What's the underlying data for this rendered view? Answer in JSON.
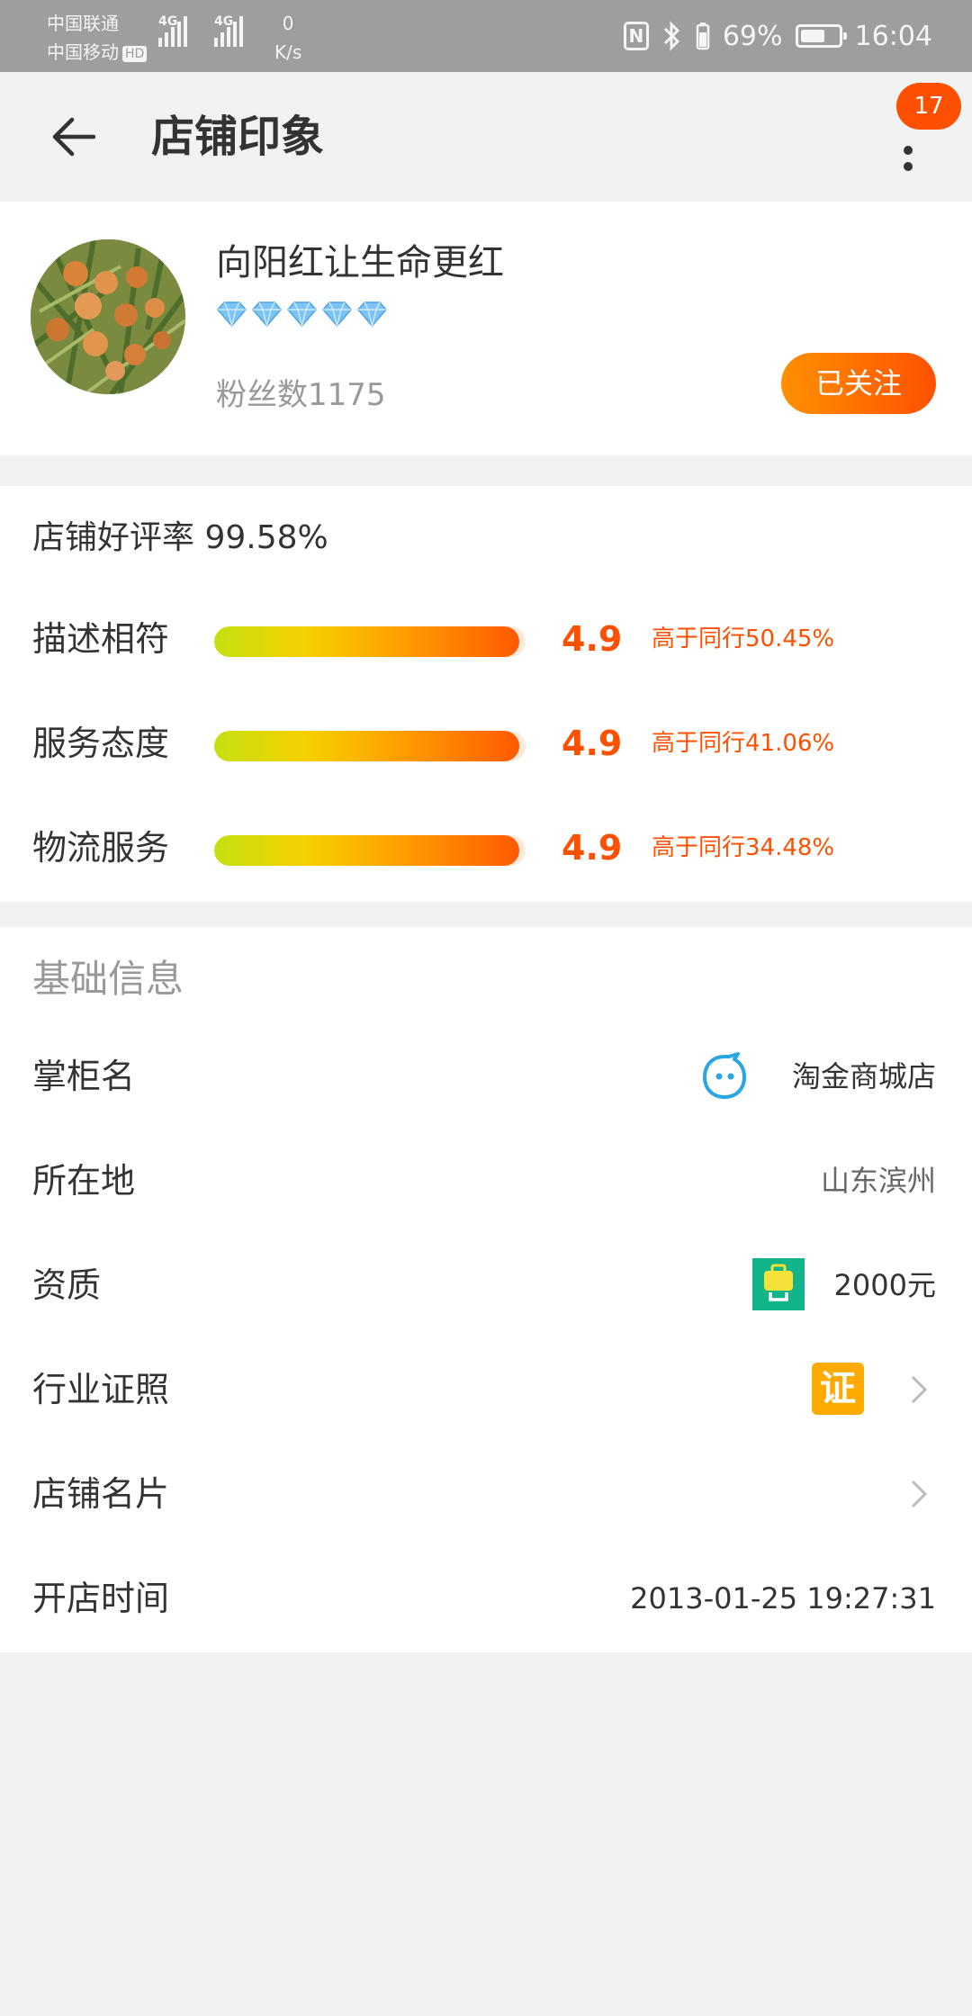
{
  "status_bar": {
    "carrier1": "中国联通",
    "carrier2": "中国移动",
    "hd": "HD",
    "net1": "4G",
    "net2": "4G",
    "speed_value": "0",
    "speed_unit": "K/s",
    "nfc": "N",
    "battery": "69%",
    "time": "16:04"
  },
  "header": {
    "title": "店铺印象",
    "notification_count": "17",
    "back_icon": "arrow-left-icon",
    "more_icon": "more-vertical-icon"
  },
  "shop": {
    "name": "向阳红让生命更红",
    "diamond_count": 5,
    "fans": "粉丝数1175",
    "follow_label": "已关注"
  },
  "ratings": {
    "good_rate": "店铺好评率 99.58%",
    "rows": [
      {
        "label": "描述相符",
        "score": "4.9",
        "level": 0.98,
        "compare": "高于同行50.45%"
      },
      {
        "label": "服务态度",
        "score": "4.9",
        "level": 0.98,
        "compare": "高于同行41.06%"
      },
      {
        "label": "物流服务",
        "score": "4.9",
        "level": 0.98,
        "compare": "高于同行34.48%"
      }
    ]
  },
  "basic_info": {
    "title": "基础信息",
    "owner_label": "掌柜名",
    "owner_value": "淘金商城店",
    "location_label": "所在地",
    "location_value": "山东滨州",
    "qualification_label": "资质",
    "qualification_value": "2000元",
    "license_label": "行业证照",
    "license_icon_text": "证",
    "card_label": "店铺名片",
    "opened_label": "开店时间",
    "opened_value": "2013-01-25 19:27:31"
  },
  "colors": {
    "accent": "#ff5000",
    "follow_start": "#ff9000",
    "follow_end": "#ff5000",
    "wangwang": "#2aa6e0",
    "deposit_icon": "#12b58a",
    "license_icon": "#ffaa00"
  }
}
